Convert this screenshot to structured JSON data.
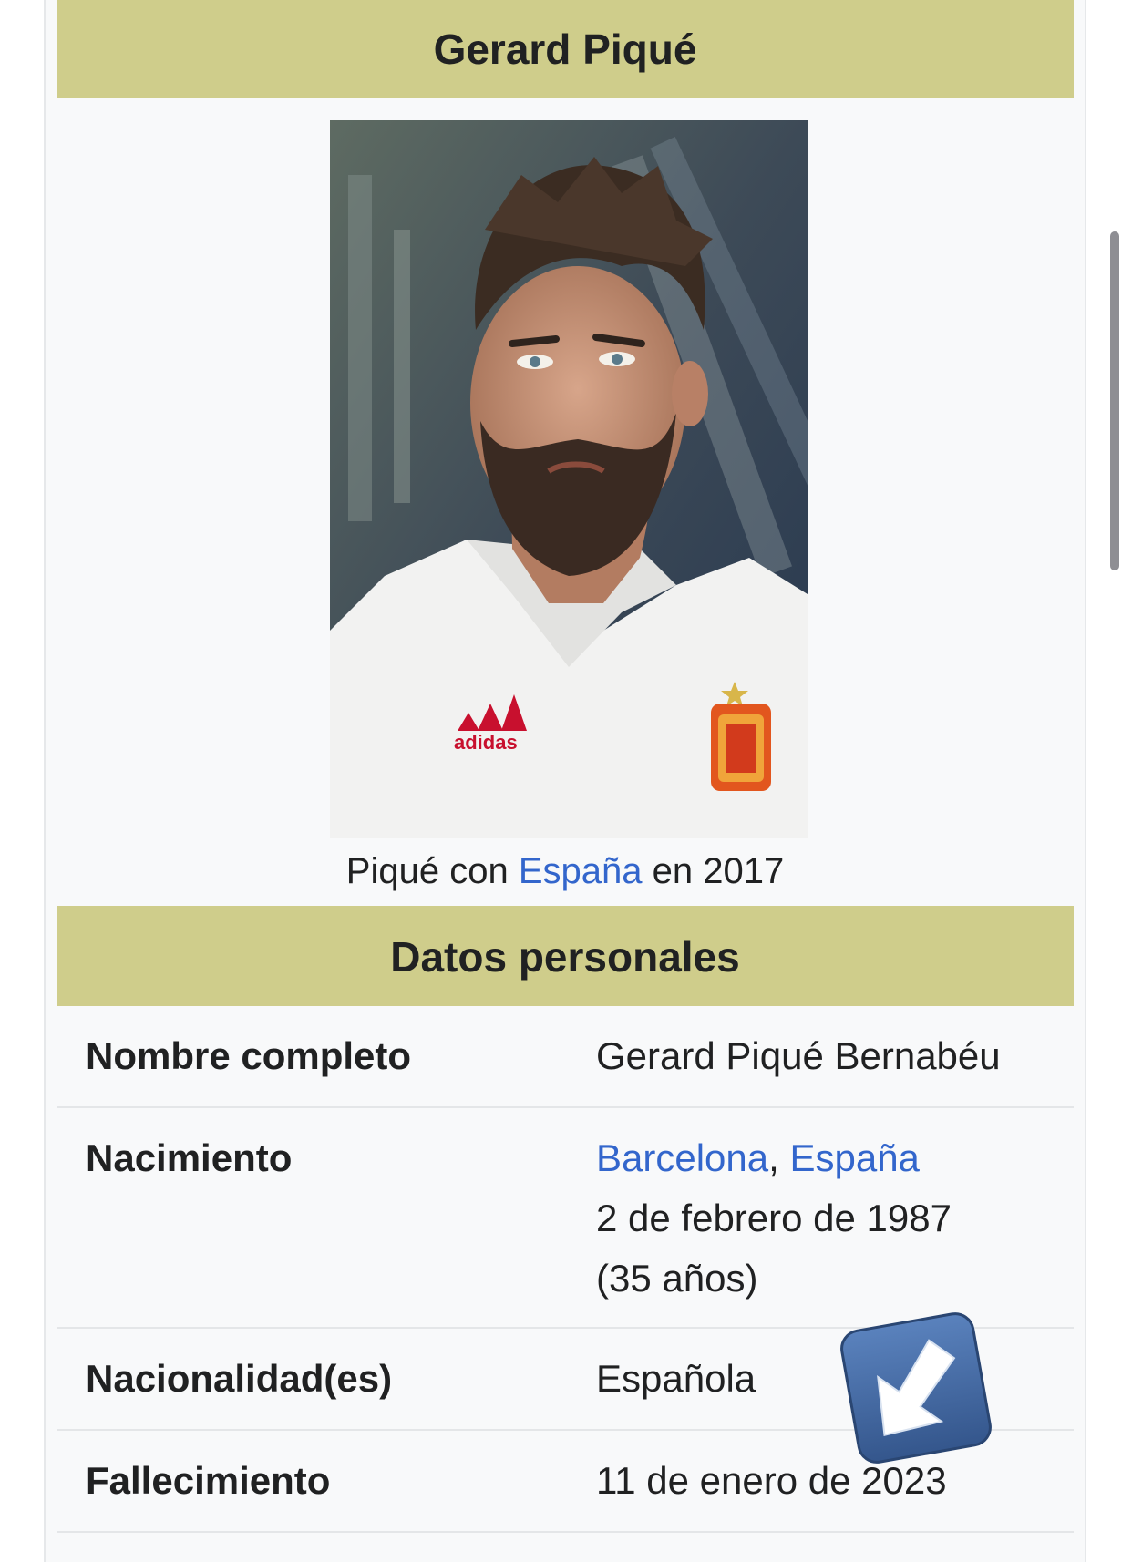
{
  "infobox": {
    "title": "Gerard Piqué",
    "caption": {
      "prefix": "Piqué con ",
      "link": "España",
      "suffix": " en 2017"
    },
    "section_personal": "Datos personales",
    "rows": {
      "full_name": {
        "label": "Nombre completo",
        "value": "Gerard Piqué Bernabéu"
      },
      "birth": {
        "label": "Nacimiento",
        "place_link_1": "Barcelona",
        "separator": ", ",
        "place_link_2": "España",
        "date": "2 de febrero de 1987",
        "age": "(35 años)"
      },
      "nationality": {
        "label": "Nacionalidad(es)",
        "value": "Española"
      },
      "death": {
        "label": "Fallecimiento",
        "value": "11 de enero de 2023"
      }
    }
  },
  "photo": {
    "jersey_brand": "adidas"
  },
  "colors": {
    "header_bg": "#cfcd8b",
    "link": "#3366cc",
    "infobox_bg": "#f8f9fa",
    "cursor_blue": "#3f6aa8"
  },
  "icons": {
    "cursor": "arrow-down-left-icon"
  }
}
